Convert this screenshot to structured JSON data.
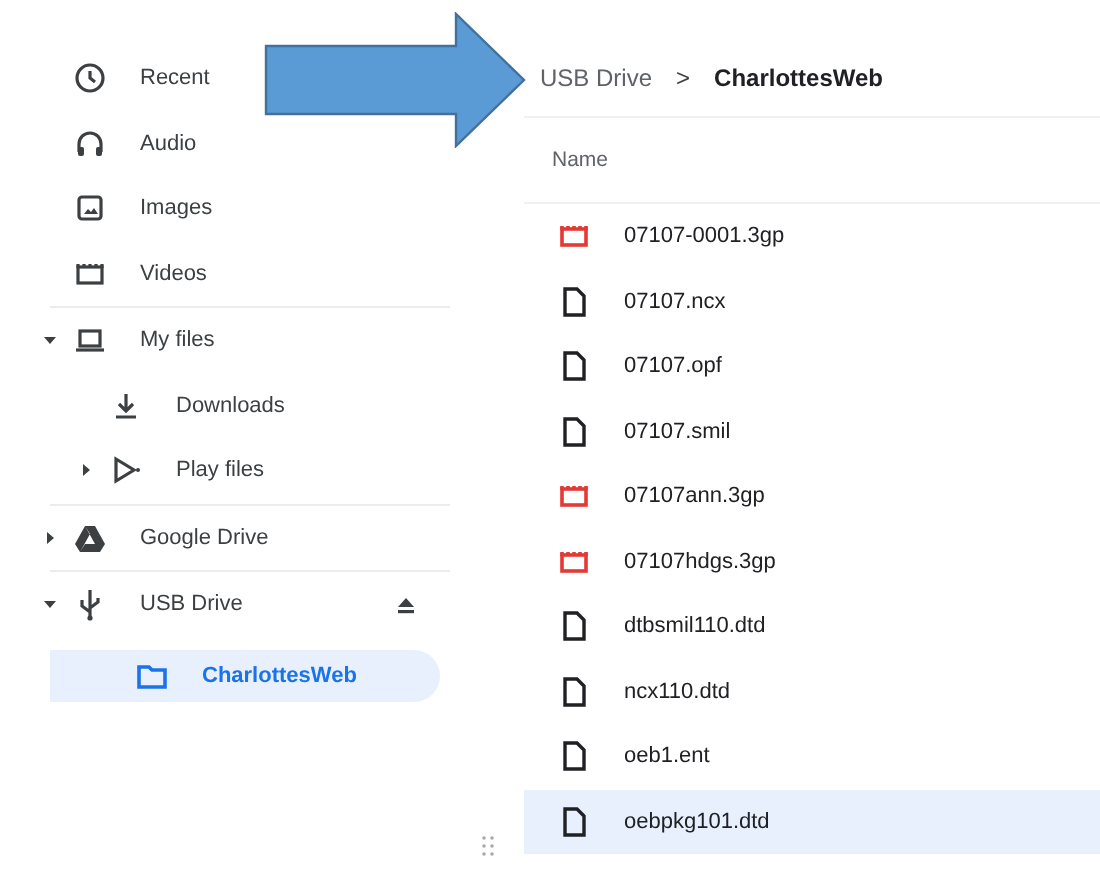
{
  "sidebar": {
    "sections": [
      {
        "items": [
          {
            "label": "Recent",
            "kind": "recent",
            "selected": false
          },
          {
            "label": "Audio",
            "kind": "audio",
            "selected": false
          },
          {
            "label": "Images",
            "kind": "images",
            "selected": false
          },
          {
            "label": "Videos",
            "kind": "videos",
            "selected": false
          }
        ]
      },
      {
        "items": [
          {
            "label": "My files",
            "kind": "computer",
            "expanded": true,
            "selected": false,
            "children": [
              {
                "label": "Downloads",
                "kind": "downloads",
                "selected": false
              },
              {
                "label": "Play files",
                "kind": "play",
                "expanded": false,
                "selected": false
              }
            ]
          }
        ]
      },
      {
        "items": [
          {
            "label": "Google Drive",
            "kind": "drive",
            "expanded": false,
            "selected": false
          }
        ]
      },
      {
        "items": [
          {
            "label": "USB Drive",
            "kind": "usb",
            "expanded": true,
            "eject": true,
            "selected": false,
            "children": [
              {
                "label": "CharlottesWeb",
                "kind": "folder",
                "selected": true
              }
            ]
          }
        ]
      }
    ]
  },
  "breadcrumb": [
    {
      "label": "USB Drive",
      "current": false
    },
    {
      "label": "CharlottesWeb",
      "current": true
    }
  ],
  "breadcrumb_separator": ">",
  "table": {
    "columns": [
      "Name"
    ],
    "rows": [
      {
        "name": "07107-0001.3gp",
        "kind": "video",
        "selected": false
      },
      {
        "name": "07107.ncx",
        "kind": "file",
        "selected": false
      },
      {
        "name": "07107.opf",
        "kind": "file",
        "selected": false
      },
      {
        "name": "07107.smil",
        "kind": "file",
        "selected": false
      },
      {
        "name": "07107ann.3gp",
        "kind": "video",
        "selected": false
      },
      {
        "name": "07107hdgs.3gp",
        "kind": "video",
        "selected": false
      },
      {
        "name": "dtbsmil110.dtd",
        "kind": "file",
        "selected": false
      },
      {
        "name": "ncx110.dtd",
        "kind": "file",
        "selected": false
      },
      {
        "name": "oeb1.ent",
        "kind": "file",
        "selected": false
      },
      {
        "name": "oebpkg101.dtd",
        "kind": "file",
        "selected": true
      }
    ]
  }
}
